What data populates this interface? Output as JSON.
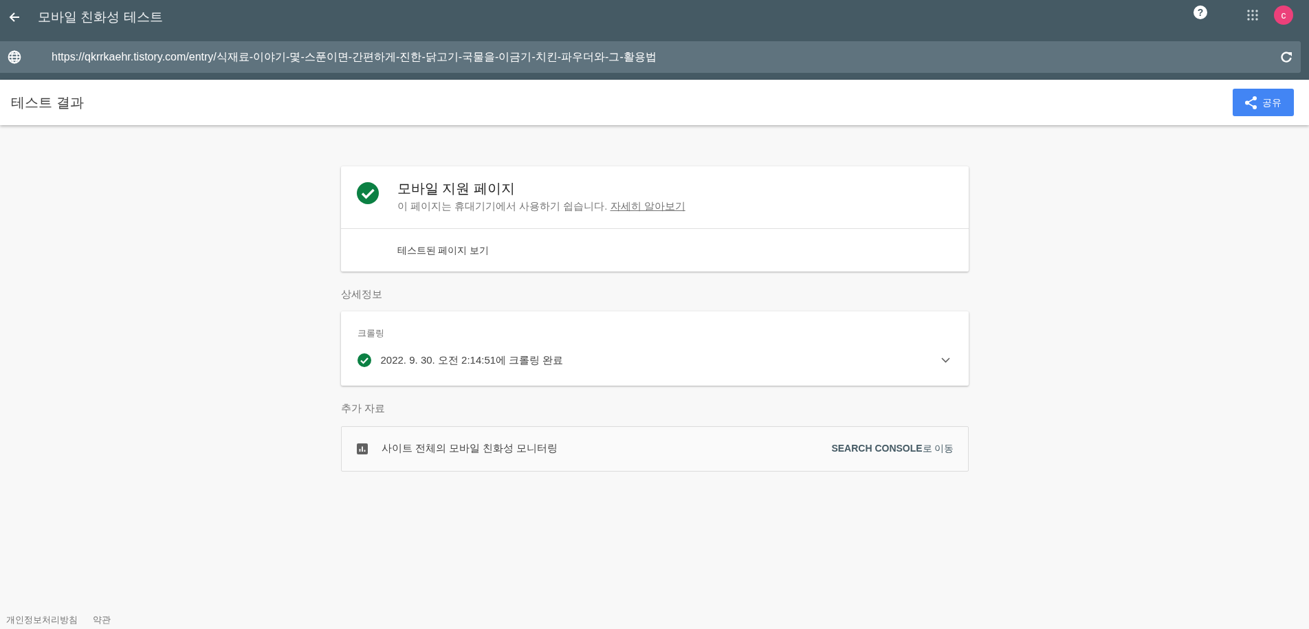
{
  "app_bar": {
    "title": "모바일 친화성 테스트",
    "avatar_letter": "c",
    "help_glyph": "?"
  },
  "url_bar": {
    "value": "https://qkrrkaehr.tistory.com/entry/식재료-이야기-몇-스푼이면-간편하게-진한-닭고기-국물을-이금기-치킨-파우더와-그-활용법"
  },
  "results_bar": {
    "title": "테스트 결과",
    "share_button": "공유"
  },
  "summary_card": {
    "title": "모바일 지원 페이지",
    "description": "이 페이지는 휴대기기에서 사용하기 쉽습니다.",
    "learn_more_link": "자세히 알아보기",
    "view_tested_page": "테스트된 페이지 보기"
  },
  "details": {
    "heading": "상세정보",
    "crawl_label": "크롤링",
    "crawl_status": "2022. 9. 30. 오전 2:14:51에 크롤링 완료",
    "expanded": false
  },
  "resources": {
    "heading": "추가 자료",
    "item_text": "사이트 전체의 모바일 친화성 모니터링",
    "item_link": "**SEARCH CONSOLE**로 이동"
  },
  "footer": {
    "links": [
      "개인정보처리방침",
      "약관"
    ]
  }
}
